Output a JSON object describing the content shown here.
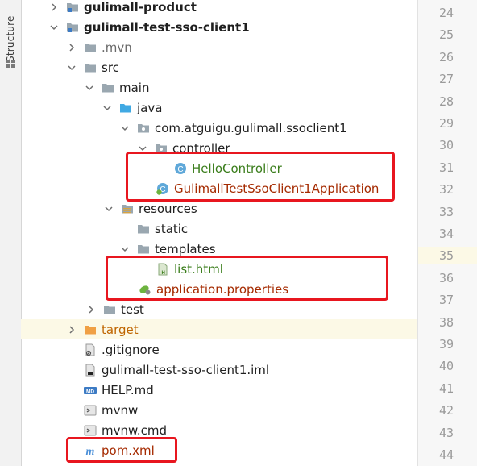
{
  "sidebar": {
    "tab_label": "Structure"
  },
  "tree": {
    "rows": [
      {
        "label": "gulimall-product",
        "style": "bold",
        "arrow": "right",
        "icon": "module-folder-icon"
      },
      {
        "label": "gulimall-test-sso-client1",
        "style": "bold",
        "arrow": "down",
        "icon": "module-folder-icon"
      },
      {
        "label": ".mvn",
        "style": "gray",
        "arrow": "right",
        "icon": "folder-icon"
      },
      {
        "label": "src",
        "style": "",
        "arrow": "down",
        "icon": "folder-icon"
      },
      {
        "label": "main",
        "style": "",
        "arrow": "down",
        "icon": "folder-icon"
      },
      {
        "label": "java",
        "style": "",
        "arrow": "down",
        "icon": "source-folder-icon"
      },
      {
        "label": "com.atguigu.gulimall.ssoclient1",
        "style": "",
        "arrow": "down",
        "icon": "package-icon"
      },
      {
        "label": "controller",
        "style": "",
        "arrow": "down",
        "icon": "package-icon"
      },
      {
        "label": "HelloController",
        "style": "green",
        "arrow": "none",
        "icon": "java-class-icon"
      },
      {
        "label": "GulimallTestSsoClient1Application",
        "style": "red",
        "arrow": "none",
        "icon": "spring-boot-class-icon"
      },
      {
        "label": "resources",
        "style": "",
        "arrow": "down",
        "icon": "resources-folder-icon"
      },
      {
        "label": "static",
        "style": "",
        "arrow": "none",
        "icon": "folder-icon"
      },
      {
        "label": "templates",
        "style": "",
        "arrow": "down",
        "icon": "folder-icon"
      },
      {
        "label": "list.html",
        "style": "green",
        "arrow": "none",
        "icon": "html-file-icon"
      },
      {
        "label": "application.properties",
        "style": "red",
        "arrow": "none",
        "icon": "spring-properties-icon"
      },
      {
        "label": "test",
        "style": "",
        "arrow": "right",
        "icon": "folder-icon"
      },
      {
        "label": "target",
        "style": "orange",
        "arrow": "right",
        "icon": "excluded-folder-icon"
      },
      {
        "label": ".gitignore",
        "style": "",
        "arrow": "none",
        "icon": "ignore-file-icon"
      },
      {
        "label": "gulimall-test-sso-client1.iml",
        "style": "",
        "arrow": "none",
        "icon": "iml-file-icon"
      },
      {
        "label": "HELP.md",
        "style": "",
        "arrow": "none",
        "icon": "markdown-file-icon"
      },
      {
        "label": "mvnw",
        "style": "",
        "arrow": "none",
        "icon": "script-file-icon"
      },
      {
        "label": "mvnw.cmd",
        "style": "",
        "arrow": "none",
        "icon": "script-file-icon"
      },
      {
        "label": "pom.xml",
        "style": "red",
        "arrow": "none",
        "icon": "maven-pom-icon"
      }
    ]
  },
  "gutter": {
    "line_numbers": [
      "24",
      "25",
      "26",
      "27",
      "28",
      "29",
      "30",
      "31",
      "32",
      "33",
      "34",
      "35",
      "36",
      "37",
      "38",
      "39",
      "40",
      "41",
      "42",
      "43",
      "44"
    ],
    "current_line": "35"
  },
  "colors": {
    "highlight_box": "#e8161f",
    "current_line_bg": "#fcf9e6",
    "modified_text": "#a52a00",
    "new_text": "#3a7d1b",
    "excluded_text": "#bf6500"
  }
}
